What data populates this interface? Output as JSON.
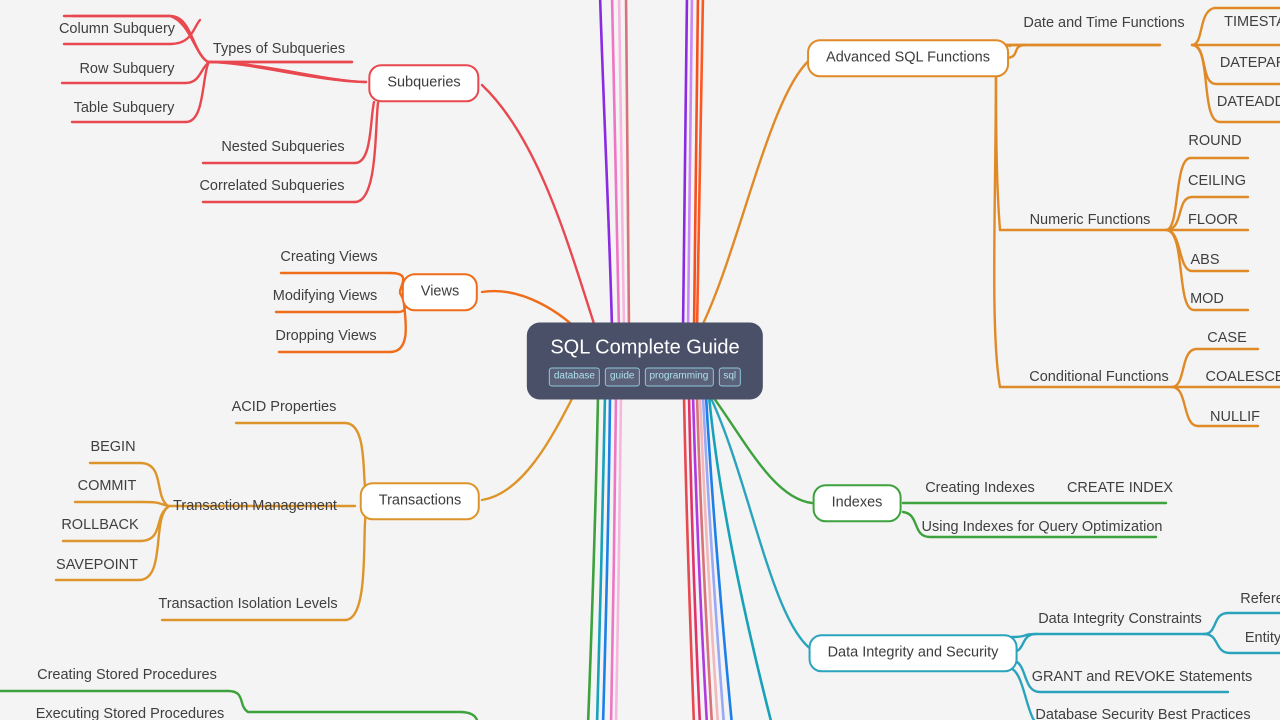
{
  "meta": {
    "background_color": "#f4f4f4",
    "text_color": "#3c3c3c",
    "root_bg": "#4a5068",
    "root_text": "#ffffff",
    "tag_text": "#aee0ef",
    "tag_border": "#8ec8dd"
  },
  "root": {
    "title": "SQL Complete Guide",
    "tags": [
      "database",
      "guide",
      "programming",
      "sql"
    ]
  },
  "branches": {
    "subqueries": {
      "label": "Subqueries",
      "color": "#e8484f",
      "children": {
        "types_of_subqueries": "Types of Subqueries",
        "column_subquery": "Column Subquery",
        "row_subquery": "Row Subquery",
        "table_subquery": "Table Subquery",
        "nested_subqueries": "Nested Subqueries",
        "correlated_subqueries": "Correlated Subqueries"
      }
    },
    "views": {
      "label": "Views",
      "color": "#ef6c1a",
      "children": {
        "creating_views": "Creating Views",
        "modifying_views": "Modifying Views",
        "dropping_views": "Dropping Views"
      }
    },
    "transactions": {
      "label": "Transactions",
      "color": "#dd952b",
      "children": {
        "acid_properties": "ACID Properties",
        "transaction_management": "Transaction Management",
        "begin": "BEGIN",
        "commit": "COMMIT",
        "rollback": "ROLLBACK",
        "savepoint": "SAVEPOINT",
        "transaction_isolation_levels": "Transaction Isolation Levels"
      }
    },
    "stored_procedures": {
      "label": "",
      "color": "#3da23d",
      "children": {
        "creating_stored_procedures": "Creating Stored Procedures",
        "executing_stored_procedures": "Executing Stored Procedures"
      }
    },
    "advanced_sql_functions": {
      "label": "Advanced SQL Functions",
      "color": "#e08a27",
      "children": {
        "date_and_time_functions": "Date and Time Functions",
        "timestamp": "TIMESTA",
        "datepart": "DATEPAR",
        "dateadd": "DATEADD",
        "numeric_functions": "Numeric Functions",
        "round": "ROUND",
        "ceiling": "CEILING",
        "floor": "FLOOR",
        "abs": "ABS",
        "mod": "MOD",
        "conditional_functions": "Conditional Functions",
        "case": "CASE",
        "coalesce": "COALESCE",
        "nullif": "NULLIF"
      }
    },
    "indexes": {
      "label": "Indexes",
      "color": "#3da23d",
      "children": {
        "creating_indexes": "Creating Indexes",
        "create_index": "CREATE INDEX",
        "using_indexes_for_query_optimization": "Using Indexes for Query Optimization"
      }
    },
    "data_integrity_and_security": {
      "label": "Data Integrity and Security",
      "color": "#2aa3bd",
      "children": {
        "data_integrity_constraints": "Data Integrity Constraints",
        "referential": "Refere",
        "entity": "Entity",
        "grant_and_revoke_statements": "GRANT and REVOKE Statements",
        "database_security_best_practices": "Database Security Best Practices"
      }
    }
  }
}
